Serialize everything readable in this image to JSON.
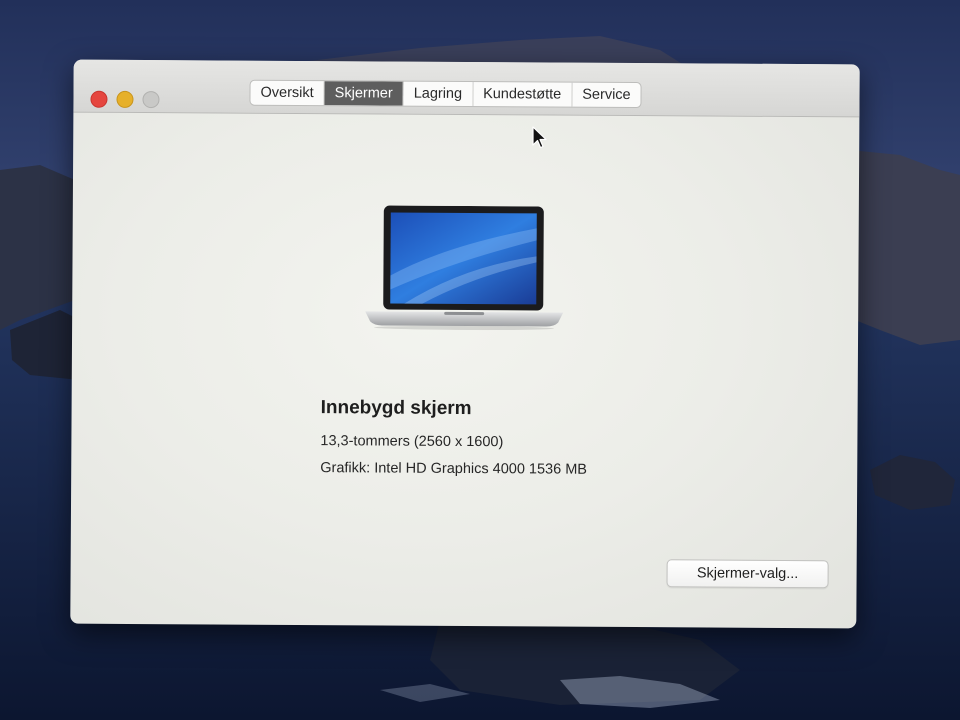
{
  "window": {
    "traffic_lights": {
      "close_color": "#e5463f",
      "minimize_color": "#e6b02a",
      "zoom_color": "#c9c9c7"
    },
    "tabs": [
      {
        "label": "Oversikt",
        "selected": false
      },
      {
        "label": "Skjermer",
        "selected": true
      },
      {
        "label": "Lagring",
        "selected": false
      },
      {
        "label": "Kundestøtte",
        "selected": false
      },
      {
        "label": "Service",
        "selected": false
      }
    ]
  },
  "display": {
    "icon": "macbook-laptop-icon",
    "title": "Innebygd skjerm",
    "size": "13,3-tommers (2560 x 1600)",
    "graphics": "Grafikk: Intel HD Graphics 4000 1536 MB",
    "prefs_button_label": "Skjermer-valg..."
  },
  "cursor": {
    "icon": "mouse-pointer-icon"
  }
}
